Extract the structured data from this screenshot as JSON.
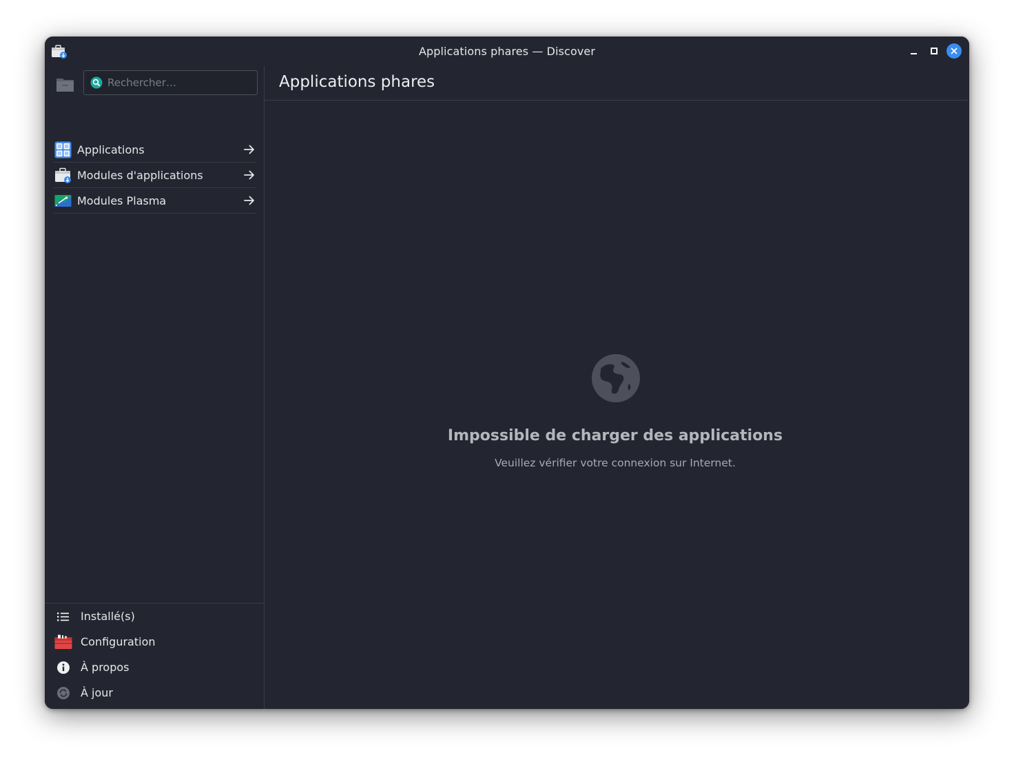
{
  "window": {
    "title": "Applications phares — Discover",
    "controls": [
      "minimize-icon",
      "maximize-icon",
      "close-icon"
    ],
    "accent": "#3b8cf0"
  },
  "sidebar": {
    "search": {
      "value": "",
      "placeholder": "Rechercher…"
    },
    "categories": [
      {
        "label": "Applications",
        "icon": "applications-grid-icon"
      },
      {
        "label": "Modules d'applications",
        "icon": "app-addons-icon"
      },
      {
        "label": "Modules Plasma",
        "icon": "plasma-addons-icon"
      }
    ],
    "nav": [
      {
        "label": "Installé(s)",
        "icon": "list-icon"
      },
      {
        "label": "Configuration",
        "icon": "toolbox-icon"
      },
      {
        "label": "À propos",
        "icon": "info-icon"
      },
      {
        "label": "À jour",
        "icon": "update-icon"
      }
    ]
  },
  "main": {
    "title": "Applications phares",
    "empty_state": {
      "icon": "globe-icon",
      "title": "Impossible de charger des applications",
      "subtitle": "Veuillez vérifier votre connexion sur Internet."
    }
  },
  "colors": {
    "background": "#232630",
    "separator": "#3a3e48",
    "text": "#e6e7ea",
    "muted_icon": "#4d505a",
    "config_red": "#e04646"
  }
}
